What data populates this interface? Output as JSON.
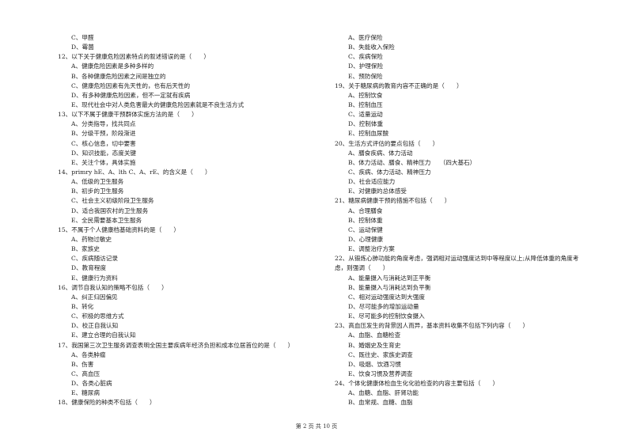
{
  "left_column": [
    {
      "type": "opt",
      "text": "C、甲醛"
    },
    {
      "type": "opt",
      "text": "D、霉菌"
    },
    {
      "type": "q",
      "text": "12、以下关于健康危险因素特点的叙述错误的是（　　）"
    },
    {
      "type": "opt",
      "text": "A、健康危险因素是多种多样的"
    },
    {
      "type": "opt",
      "text": "B、各种健康危险因素之间是独立的"
    },
    {
      "type": "opt",
      "text": "C、健康危险因素有先天性的，也有后天性的"
    },
    {
      "type": "opt",
      "text": "D、有多种健康危险因素，但不一定就有疾病"
    },
    {
      "type": "opt",
      "text": "E、现代社会中对人类危害最大的健康危险因素就是不良生活方式"
    },
    {
      "type": "q",
      "text": "13、以下不属于健康干预群体实施方法的是（　　）"
    },
    {
      "type": "opt",
      "text": "A、分类指导，找共同点"
    },
    {
      "type": "opt",
      "text": "B、分级干预，阶段渐进"
    },
    {
      "type": "opt",
      "text": "C、核心信息，切中要害"
    },
    {
      "type": "opt",
      "text": "D、知识技能，态度关键"
    },
    {
      "type": "opt",
      "text": "E、关注个体，具体实施"
    },
    {
      "type": "q",
      "text": "14、primry hE、A、lth C、A、rE、的含义是（　　）"
    },
    {
      "type": "opt",
      "text": "A、低级的卫生服务"
    },
    {
      "type": "opt",
      "text": "B、初步的卫生服务"
    },
    {
      "type": "opt",
      "text": "C、社会主义初级阶段卫生服务"
    },
    {
      "type": "opt",
      "text": "D、适合我国农村的卫生服务"
    },
    {
      "type": "opt",
      "text": "E、全民需要基本卫生服务"
    },
    {
      "type": "q",
      "text": "15、不属于个人健康档基础资料的是（　　）"
    },
    {
      "type": "opt",
      "text": "A、药物过敏史"
    },
    {
      "type": "opt",
      "text": "B、家族史"
    },
    {
      "type": "opt",
      "text": "C、疾病随访记录"
    },
    {
      "type": "opt",
      "text": "D、教育程度"
    },
    {
      "type": "opt",
      "text": "E、健康行为资料"
    },
    {
      "type": "q",
      "text": "16、调节自我认知的策略不包括（　　）"
    },
    {
      "type": "opt",
      "text": "A、纠正归因偏见"
    },
    {
      "type": "opt",
      "text": "B、转化"
    },
    {
      "type": "opt",
      "text": "C、积极的思维方式"
    },
    {
      "type": "opt",
      "text": "D、校正自我认知"
    },
    {
      "type": "opt",
      "text": "E、建立合理的自我认知"
    },
    {
      "type": "q",
      "text": "17、我国第三次卫生服务调查表明全国主要疾病年经济负担和成本位居首位的是（　　）"
    },
    {
      "type": "opt",
      "text": "A、各类肿瘤"
    },
    {
      "type": "opt",
      "text": "B、伤害"
    },
    {
      "type": "opt",
      "text": "C、高血压"
    },
    {
      "type": "opt",
      "text": "D、各类心脏病"
    },
    {
      "type": "opt",
      "text": "E、糖尿病"
    },
    {
      "type": "q",
      "text": "18、健康保险的种类不包括（　　）"
    }
  ],
  "right_column": [
    {
      "type": "opt",
      "text": "A、医疗保险"
    },
    {
      "type": "opt",
      "text": "B、失能收入保险"
    },
    {
      "type": "opt",
      "text": "C、疾病保险"
    },
    {
      "type": "opt",
      "text": "D、护理保险"
    },
    {
      "type": "opt",
      "text": "E、预防保险"
    },
    {
      "type": "q",
      "text": "19、关于糖尿病的教育内容不正确的是（　　）"
    },
    {
      "type": "opt",
      "text": "A、控制饮食"
    },
    {
      "type": "opt",
      "text": "B、控制血压"
    },
    {
      "type": "opt",
      "text": "C、适量运动"
    },
    {
      "type": "opt",
      "text": "D、控制体重"
    },
    {
      "type": "opt",
      "text": "E、控制血尿酸"
    },
    {
      "type": "q",
      "text": "20、生活方式评估的要点包括（　　）"
    },
    {
      "type": "opt",
      "text": "A、膳食疾病、体力活动"
    },
    {
      "type": "opt",
      "text": "B、体力活动、膳食、精神压力　　（四大基石）"
    },
    {
      "type": "opt",
      "text": "C、疾病、体力活动、精神压力"
    },
    {
      "type": "opt",
      "text": "D、社会适应能力"
    },
    {
      "type": "opt",
      "text": "E、对健康的总体感受"
    },
    {
      "type": "q",
      "text": "21、糖尿病健康干预的措施不包括（　　）"
    },
    {
      "type": "opt",
      "text": "A、合理膳食"
    },
    {
      "type": "opt",
      "text": "B、控制体重"
    },
    {
      "type": "opt",
      "text": "C、运动保健"
    },
    {
      "type": "opt",
      "text": "D、心理健康"
    },
    {
      "type": "opt",
      "text": "E、调整治疗方案"
    },
    {
      "type": "q",
      "text": "22、从锻炼心肺功能的角度考虑，强调相对运动强度达到中等程度以上;从降低体重的角度考"
    },
    {
      "type": "q",
      "text": "虑，则强调（　　）"
    },
    {
      "type": "opt",
      "text": "A、能量摄入与消耗达到正平衡"
    },
    {
      "type": "opt",
      "text": "B、能量摄入与消耗达到负平衡"
    },
    {
      "type": "opt",
      "text": "C、相对运动强度达到大强度"
    },
    {
      "type": "opt",
      "text": "D、尽可能多的增加运动量"
    },
    {
      "type": "opt",
      "text": "E、尽可能多的控制饮食摄入"
    },
    {
      "type": "q",
      "text": "23、高血压发生的背景因人而异，基本资料收集不包括下列内容（　　）"
    },
    {
      "type": "opt",
      "text": "A、血脂、血糖检查"
    },
    {
      "type": "opt",
      "text": "B、婚姻史及生育史"
    },
    {
      "type": "opt",
      "text": "C、既往史、家族史调查"
    },
    {
      "type": "opt",
      "text": "D、吸烟、饮酒习惯"
    },
    {
      "type": "opt",
      "text": "E、饮食习惯及营养调查"
    },
    {
      "type": "q",
      "text": "24、个体化健康体检血生化化验检查的内容主要包括（　　）"
    },
    {
      "type": "opt",
      "text": "A、血糖、血脂、肝肾功能"
    },
    {
      "type": "opt",
      "text": "B、血常规、血糖、血脂"
    }
  ],
  "footer": {
    "page_label": "第 2 页 共 10 页"
  }
}
